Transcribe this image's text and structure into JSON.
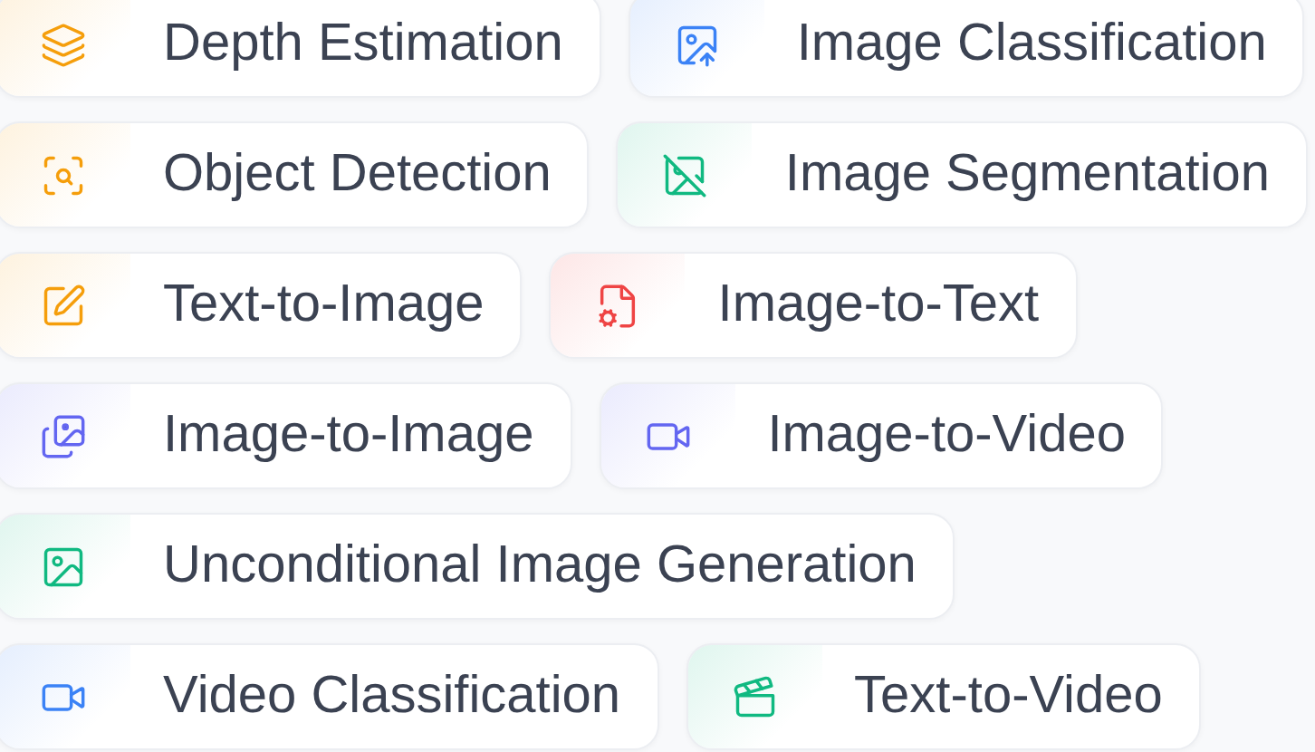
{
  "rows": [
    {
      "tasks": [
        {
          "label": "Depth Estimation",
          "color": "#f59e0b"
        },
        {
          "label": "Image Classification",
          "color": "#3b82f6"
        }
      ]
    },
    {
      "tasks": [
        {
          "label": "Object Detection",
          "color": "#f59e0b"
        },
        {
          "label": "Image Segmentation",
          "color": "#10b981"
        }
      ]
    },
    {
      "tasks": [
        {
          "label": "Text-to-Image",
          "color": "#f59e0b"
        },
        {
          "label": "Image-to-Text",
          "color": "#ef4444"
        }
      ]
    },
    {
      "tasks": [
        {
          "label": "Image-to-Image",
          "color": "#6366f1"
        },
        {
          "label": "Image-to-Video",
          "color": "#6366f1"
        }
      ]
    },
    {
      "tasks": [
        {
          "label": "Unconditional Image Generation",
          "color": "#10b981"
        }
      ]
    },
    {
      "tasks": [
        {
          "label": "Video Classification",
          "color": "#3b82f6"
        },
        {
          "label": "Text-to-Video",
          "color": "#10b981"
        }
      ]
    }
  ]
}
